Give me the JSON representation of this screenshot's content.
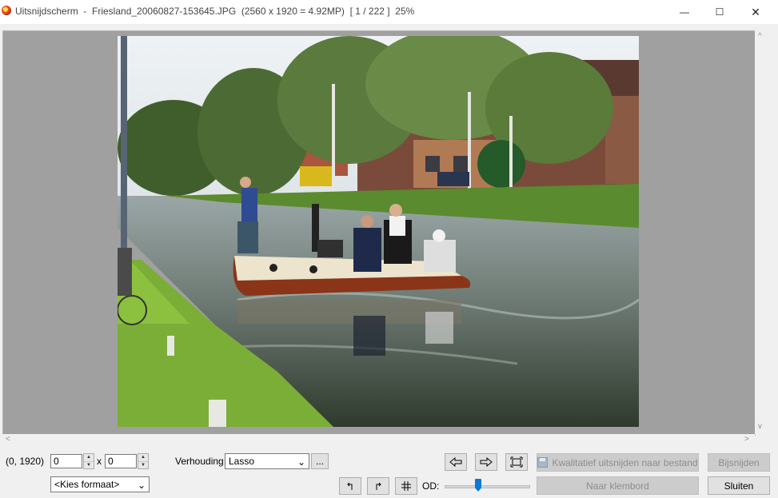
{
  "window": {
    "title": "Uitsnijdscherm  -  Friesland_20060827-153645.JPG  (2560 x 1920 = 4.92MP)  [ 1 / 222 ]  25%",
    "minimize_glyph": "—",
    "maximize_glyph": "☐",
    "close_glyph": "✕"
  },
  "scroll": {
    "up": "^",
    "down": "v",
    "left": "<",
    "right": ">"
  },
  "controls": {
    "coords": "(0, 1920)",
    "width_value": "0",
    "height_value": "0",
    "times": "x",
    "ratio_label": "Verhouding:",
    "ratio_value": "Lasso",
    "ellipsis": "...",
    "format_value": "<Kies formaat>",
    "od_label": "OD:",
    "od_level": 0.4,
    "prev_icon": "arrow-left-icon",
    "next_icon": "arrow-right-icon",
    "fit_icon": "fit-screen-icon",
    "rotate_left_icon": "rotate-left-icon",
    "rotate_right_icon": "rotate-right-icon",
    "grid_icon": "grid-icon",
    "save_quality_label": "Kwalitatief uitsnijden naar bestand",
    "crop_label": "Bijsnijden",
    "clipboard_label": "Naar klembord",
    "close_label": "Sluiten"
  },
  "colors": {
    "canvas_bg": "#a0a0a0",
    "accent": "#0a78d7",
    "disabled_text": "#8d8d8d"
  }
}
